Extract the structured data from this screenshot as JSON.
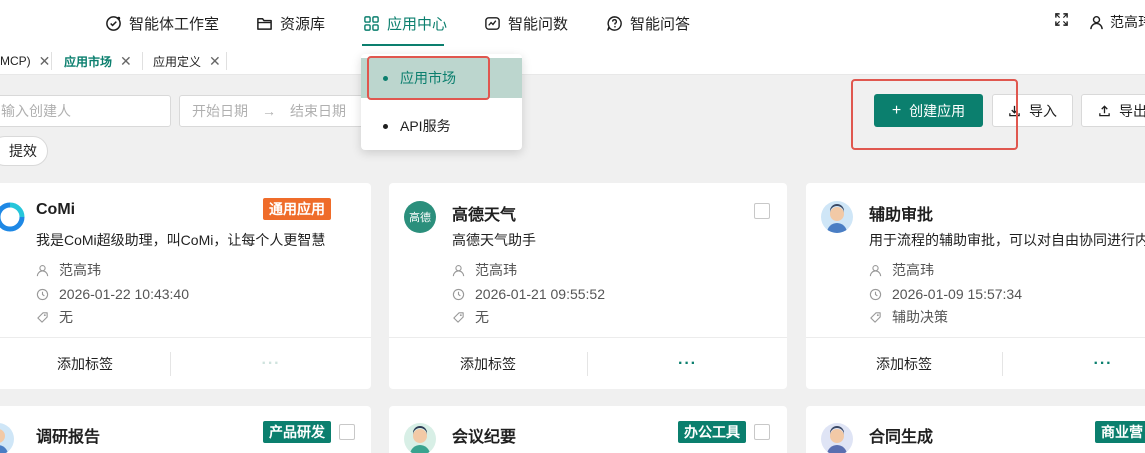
{
  "nav": {
    "items": [
      {
        "label": "智能体工作室",
        "icon": "agent-studio-icon"
      },
      {
        "label": "资源库",
        "icon": "folder-icon"
      },
      {
        "label": "应用中心",
        "icon": "app-grid-icon",
        "active": true
      },
      {
        "label": "智能问数",
        "icon": "data-query-icon"
      },
      {
        "label": "智能问答",
        "icon": "question-icon"
      }
    ],
    "user_name": "范高玮",
    "accent": "#0b7f6e"
  },
  "tabs": [
    {
      "label": "MCP)"
    },
    {
      "label": "应用市场",
      "active": true
    },
    {
      "label": "应用定义"
    }
  ],
  "filters": {
    "creator_placeholder": "输入创建人",
    "start_date_placeholder": "开始日期",
    "end_date_placeholder": "结束日期",
    "date_separator": "→",
    "effective_chip": "提效"
  },
  "actions": {
    "create_label": "创建应用",
    "import_label": "导入",
    "export_label": "导出"
  },
  "dropdown": {
    "items": [
      {
        "label": "应用市场",
        "active": true
      },
      {
        "label": "API服务"
      }
    ]
  },
  "cards": [
    {
      "title": "CoMi",
      "desc": "我是CoMi超级助理，叫CoMi，让每个人更智慧",
      "author": "范高玮",
      "time": "2026-01-22 10:43:40",
      "tag_value": "无",
      "badge": "通用应用",
      "badge_color": "#ef6c2a",
      "add_tag": "添加标签",
      "more": "···"
    },
    {
      "title": "高德天气",
      "avatar_text": "高德",
      "desc": "高德天气助手",
      "author": "范高玮",
      "time": "2026-01-21 09:55:52",
      "tag_value": "无",
      "add_tag": "添加标签",
      "more": "···"
    },
    {
      "title": "辅助审批",
      "desc": "用于流程的辅助审批，可以对自由协同进行内",
      "author": "范高玮",
      "time": "2026-01-09 15:57:34",
      "tag_value": "辅助决策",
      "add_tag": "添加标签",
      "more": "···"
    },
    {
      "title": "调研报告",
      "badge": "产品研发",
      "badge_color": "#0b7f6e"
    },
    {
      "title": "会议纪要",
      "badge": "办公工具",
      "badge_color": "#0b7f6e"
    },
    {
      "title": "合同生成",
      "badge": "商业营",
      "badge_color": "#0b7f6e"
    }
  ]
}
